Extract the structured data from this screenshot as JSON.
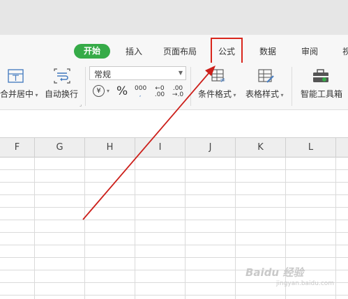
{
  "ribbon_tabs": {
    "active": "开始",
    "insert": "插入",
    "page_layout": "页面布局",
    "formulas": "公式",
    "data": "数据",
    "review": "审阅",
    "view_partial": "视"
  },
  "ribbon": {
    "merge_center": "合并居中",
    "wrap_text": "自动换行",
    "number_format": "常规",
    "currency_symbol": "¥",
    "percent_symbol": "%",
    "thousands": "000",
    "increase_decimal": "←0\n.00",
    "decrease_decimal": ".00\n→.0",
    "conditional_format": "条件格式",
    "table_style": "表格样式",
    "smart_toolbox": "智能工具箱"
  },
  "columns": [
    "F",
    "G",
    "H",
    "I",
    "J",
    "K",
    "L"
  ],
  "watermark": {
    "text": "Baidu 经验",
    "sub": "jingyan.baidu.com"
  },
  "colors": {
    "active_tab": "#36ab48",
    "highlight": "#d9261c",
    "arrow": "#cc1f1a"
  }
}
